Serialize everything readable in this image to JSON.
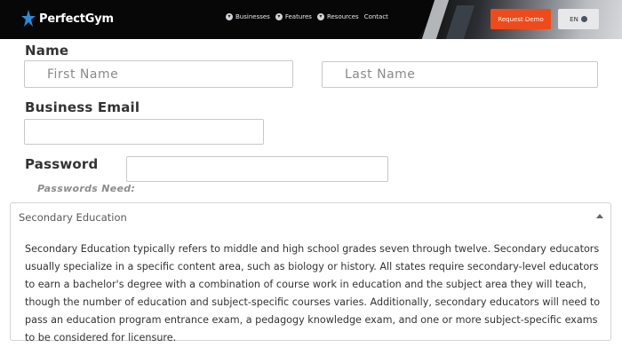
{
  "header": {
    "brand": "PerfectGym",
    "nav": [
      {
        "label": "Businesses",
        "icon": "chevron-icon"
      },
      {
        "label": "Features",
        "icon": "chevron-icon"
      },
      {
        "label": "Resources",
        "icon": "chevron-icon"
      },
      {
        "label": "Contact"
      }
    ],
    "request_demo": "Request Demo",
    "language": "EN",
    "accent_color": "#f04a1a",
    "brand_accent": "#2a8bd8"
  },
  "form": {
    "name_label": "Name",
    "first_name_placeholder": "First Name",
    "last_name_placeholder": "Last Name",
    "email_label": "Business Email",
    "email_value": "",
    "password_label": "Password",
    "password_value": "",
    "password_hint": "Passwords Need:"
  },
  "accordion": {
    "title": "Secondary Education",
    "body": "Secondary Education typically refers to middle and high school grades seven through twelve. Secondary educators usually specialize in a specific content area, such as biology or history. All states require secondary-level educators to earn a bachelor's degree with a combination of course work in education and the subject area they will teach, though the number of education and subject-specific courses varies. Additionally, secondary educators will need to pass an education program entrance exam, a pedagogy knowledge exam, and one or more subject-specific exams to be considered for licensure.",
    "expanded": true
  }
}
